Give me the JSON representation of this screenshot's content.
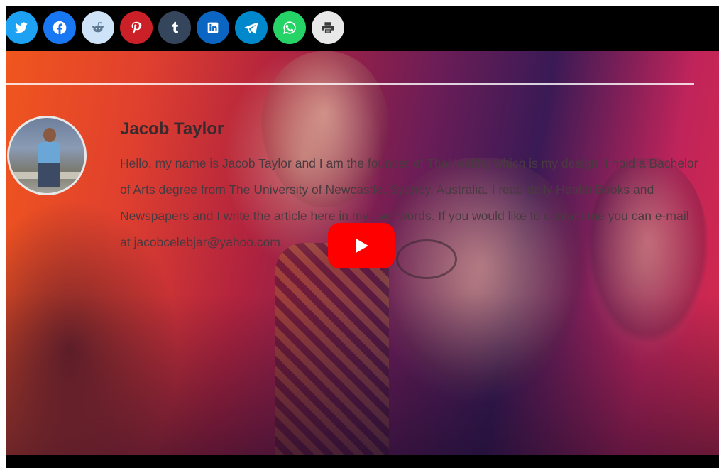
{
  "share_bar": {
    "buttons": [
      {
        "icon": "twitter-icon",
        "color": "#1da1f2"
      },
      {
        "icon": "facebook-icon",
        "color": "#1877f2"
      },
      {
        "icon": "reddit-icon",
        "color": "#cee3f8"
      },
      {
        "icon": "pinterest-icon",
        "color": "#cb2027"
      },
      {
        "icon": "tumblr-icon",
        "color": "#35465c"
      },
      {
        "icon": "linkedin-icon",
        "color": "#0a66c2"
      },
      {
        "icon": "telegram-icon",
        "color": "#0088cc"
      },
      {
        "icon": "whatsapp-icon",
        "color": "#25d366"
      },
      {
        "icon": "print-icon",
        "color": "#e8e8e8"
      }
    ]
  },
  "author": {
    "name": "Jacob Taylor",
    "bio": "Hello, my name is Jacob Taylor and I am the founder of TheHealthy which is my design. I hold a Bachelor of Arts degree from The University of Newcastle, Sydney, Australia. I read daily Health Books and Newspapers and I write the article here in my own words. If you would like to contact me you can e-mail at jacobcelebjar@yahoo.com."
  },
  "video": {
    "play_button_color": "#ff0000",
    "play_icon": "play-icon"
  }
}
